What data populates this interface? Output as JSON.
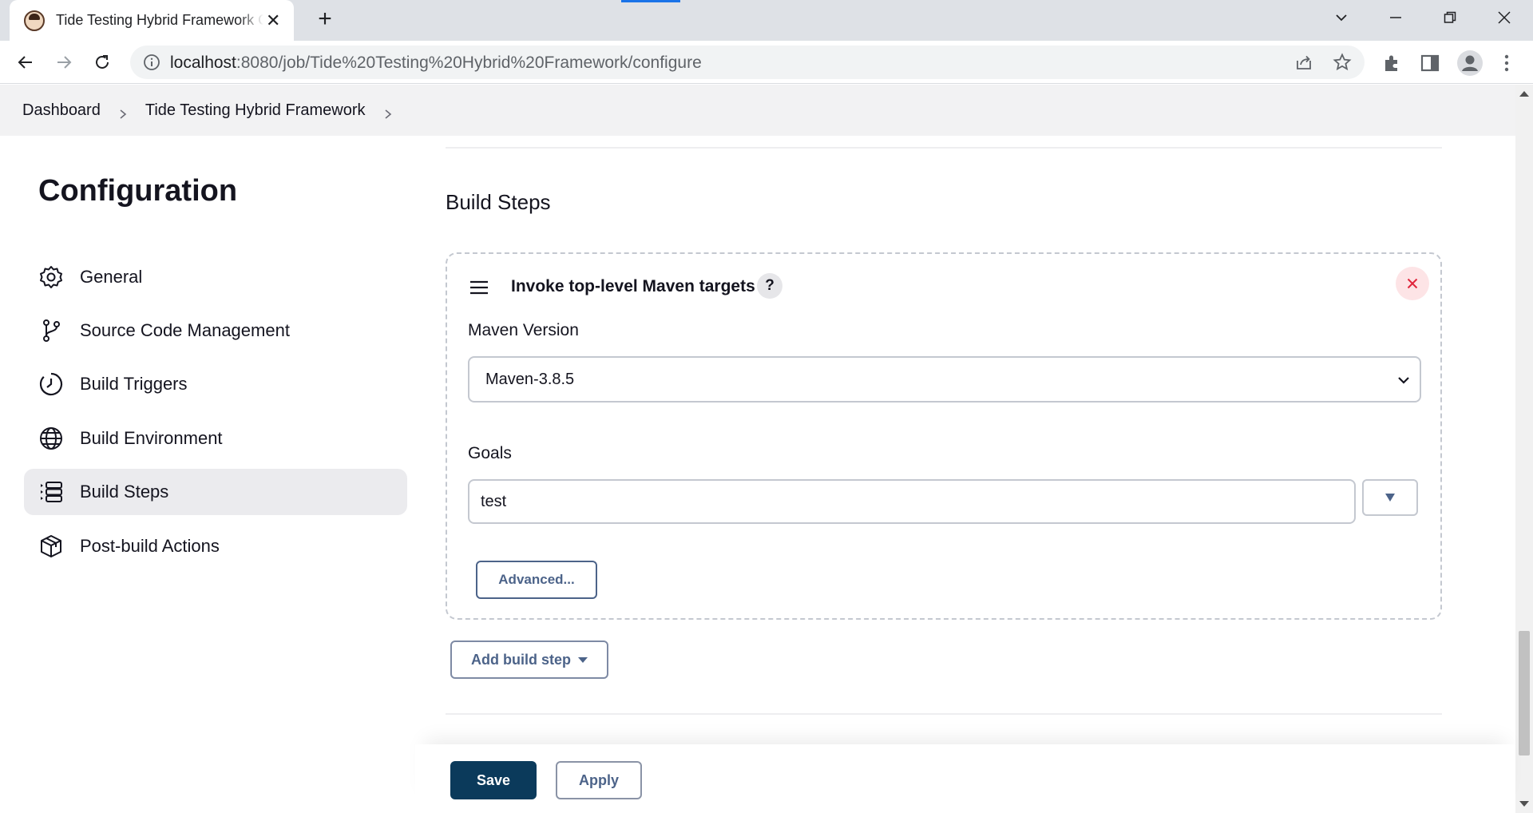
{
  "browser": {
    "tab_title": "Tide Testing Hybrid Framework Config",
    "new_tab_symbol": "+",
    "close_symbol": "✕",
    "url_host": "localhost",
    "url_path": ":8080/job/Tide%20Testing%20Hybrid%20Framework/configure"
  },
  "breadcrumb": {
    "items": [
      "Dashboard",
      "Tide Testing Hybrid Framework"
    ]
  },
  "sidebar": {
    "title": "Configuration",
    "items": [
      {
        "label": "General",
        "icon": "gear-icon"
      },
      {
        "label": "Source Code Management",
        "icon": "branch-icon"
      },
      {
        "label": "Build Triggers",
        "icon": "clock-icon"
      },
      {
        "label": "Build Environment",
        "icon": "globe-icon"
      },
      {
        "label": "Build Steps",
        "icon": "list-icon",
        "active": true
      },
      {
        "label": "Post-build Actions",
        "icon": "package-icon"
      }
    ]
  },
  "main": {
    "section_title": "Build Steps",
    "step": {
      "title": "Invoke top-level Maven targets",
      "help": "?",
      "maven_version_label": "Maven Version",
      "maven_version_value": "Maven-3.8.5",
      "goals_label": "Goals",
      "goals_value": "test",
      "advanced_label": "Advanced..."
    },
    "add_build_step_label": "Add build step"
  },
  "footer": {
    "save_label": "Save",
    "apply_label": "Apply"
  },
  "colors": {
    "save_bg": "#0b3a5b",
    "link_blue": "#4c6389",
    "remove_red": "#e0263c",
    "active_bg": "#ebebee"
  }
}
